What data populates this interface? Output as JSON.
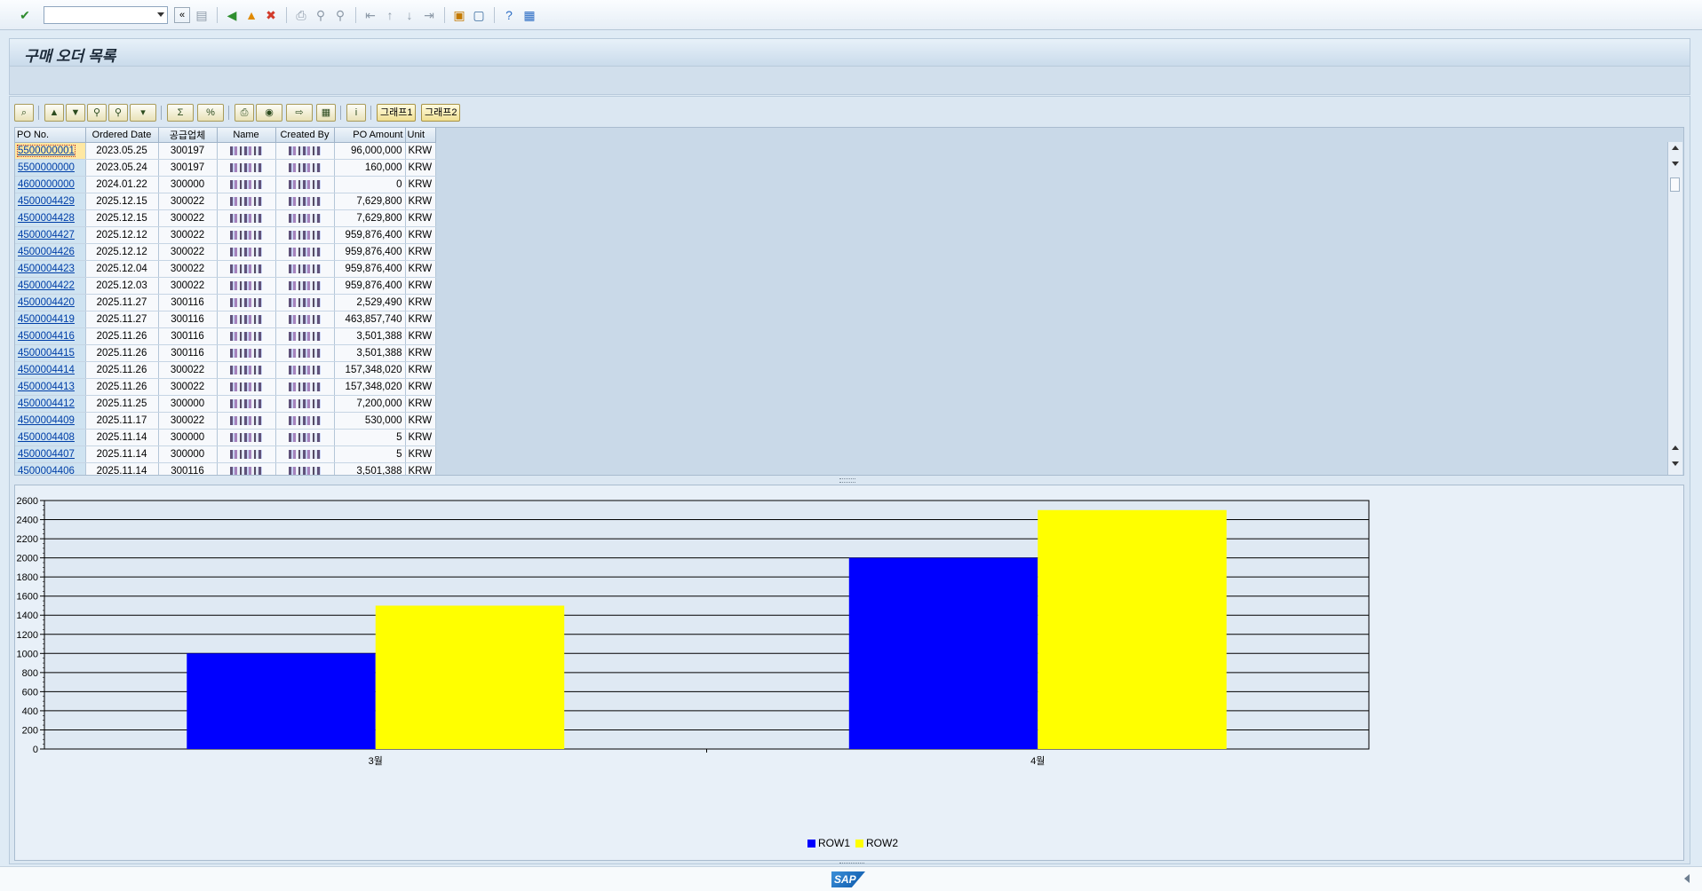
{
  "toolbar": {
    "command_field_value": "",
    "icons": [
      "enter-icon",
      "back-icon",
      "exit-icon",
      "cancel-icon",
      "print-icon",
      "find-icon",
      "find-next-icon",
      "first-page-icon",
      "prev-page-icon",
      "next-page-icon",
      "last-page-icon",
      "new-session-icon",
      "shortcut-icon",
      "help-icon",
      "customize-layout-icon"
    ]
  },
  "title": "구매 오더 목록",
  "alv_toolbar": {
    "graph1_label": "그래프1",
    "graph2_label": "그래프2"
  },
  "table": {
    "columns": [
      "PO No.",
      "Ordered Date",
      "공급업체",
      "Name",
      "Created By",
      "PO Amount",
      "Unit"
    ],
    "rows": [
      {
        "po": "5500000001",
        "date": "2023.05.25",
        "vendor": "300197",
        "amount": "96,000,000",
        "unit": "KRW"
      },
      {
        "po": "5500000000",
        "date": "2023.05.24",
        "vendor": "300197",
        "amount": "160,000",
        "unit": "KRW"
      },
      {
        "po": "4600000000",
        "date": "2024.01.22",
        "vendor": "300000",
        "amount": "0",
        "unit": "KRW"
      },
      {
        "po": "4500004429",
        "date": "2025.12.15",
        "vendor": "300022",
        "amount": "7,629,800",
        "unit": "KRW"
      },
      {
        "po": "4500004428",
        "date": "2025.12.15",
        "vendor": "300022",
        "amount": "7,629,800",
        "unit": "KRW"
      },
      {
        "po": "4500004427",
        "date": "2025.12.12",
        "vendor": "300022",
        "amount": "959,876,400",
        "unit": "KRW"
      },
      {
        "po": "4500004426",
        "date": "2025.12.12",
        "vendor": "300022",
        "amount": "959,876,400",
        "unit": "KRW"
      },
      {
        "po": "4500004423",
        "date": "2025.12.04",
        "vendor": "300022",
        "amount": "959,876,400",
        "unit": "KRW"
      },
      {
        "po": "4500004422",
        "date": "2025.12.03",
        "vendor": "300022",
        "amount": "959,876,400",
        "unit": "KRW"
      },
      {
        "po": "4500004420",
        "date": "2025.11.27",
        "vendor": "300116",
        "amount": "2,529,490",
        "unit": "KRW"
      },
      {
        "po": "4500004419",
        "date": "2025.11.27",
        "vendor": "300116",
        "amount": "463,857,740",
        "unit": "KRW"
      },
      {
        "po": "4500004416",
        "date": "2025.11.26",
        "vendor": "300116",
        "amount": "3,501,388",
        "unit": "KRW"
      },
      {
        "po": "4500004415",
        "date": "2025.11.26",
        "vendor": "300116",
        "amount": "3,501,388",
        "unit": "KRW"
      },
      {
        "po": "4500004414",
        "date": "2025.11.26",
        "vendor": "300022",
        "amount": "157,348,020",
        "unit": "KRW"
      },
      {
        "po": "4500004413",
        "date": "2025.11.26",
        "vendor": "300022",
        "amount": "157,348,020",
        "unit": "KRW"
      },
      {
        "po": "4500004412",
        "date": "2025.11.25",
        "vendor": "300000",
        "amount": "7,200,000",
        "unit": "KRW"
      },
      {
        "po": "4500004409",
        "date": "2025.11.17",
        "vendor": "300022",
        "amount": "530,000",
        "unit": "KRW"
      },
      {
        "po": "4500004408",
        "date": "2025.11.14",
        "vendor": "300000",
        "amount": "5",
        "unit": "KRW"
      },
      {
        "po": "4500004407",
        "date": "2025.11.14",
        "vendor": "300000",
        "amount": "5",
        "unit": "KRW"
      },
      {
        "po": "4500004406",
        "date": "2025.11.14",
        "vendor": "300116",
        "amount": "3,501,388",
        "unit": "KRW"
      }
    ]
  },
  "chart_data": {
    "type": "bar",
    "categories": [
      "3월",
      "4월"
    ],
    "series": [
      {
        "name": "ROW1",
        "color": "#0000ff",
        "values": [
          1000,
          2000
        ]
      },
      {
        "name": "ROW2",
        "color": "#ffff00",
        "values": [
          1500,
          2500
        ]
      }
    ],
    "ylim": [
      0,
      2600
    ],
    "yticks": [
      0,
      200,
      400,
      600,
      800,
      1000,
      1200,
      1400,
      1600,
      1800,
      2000,
      2200,
      2400,
      2600
    ],
    "grid": true,
    "legend_position": "bottom-center"
  },
  "status": {
    "logo": "SAP"
  }
}
